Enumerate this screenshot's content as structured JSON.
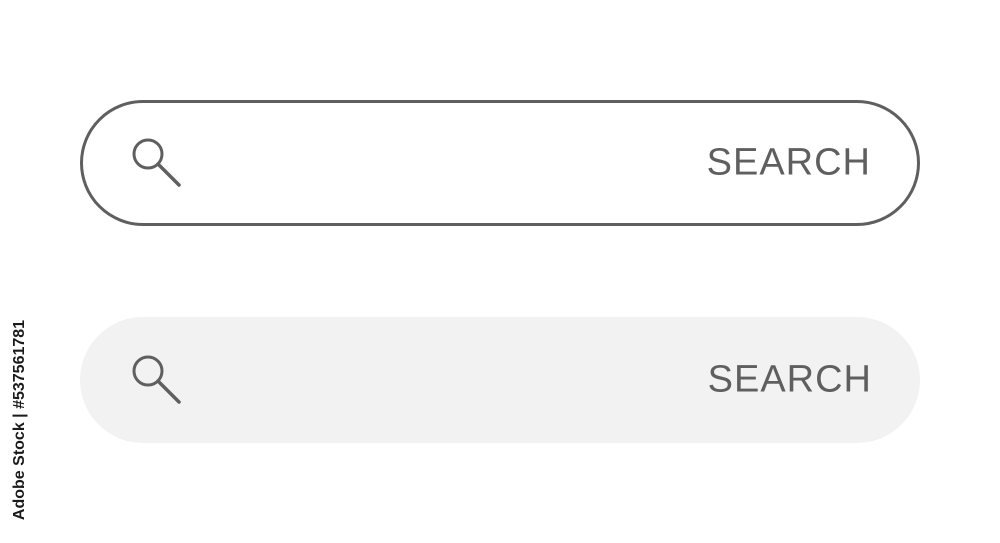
{
  "search_bars": [
    {
      "style": "outlined",
      "label": "SEARCH",
      "icon": "search-icon",
      "border_color": "#5f5f5f",
      "background_color": "#ffffff"
    },
    {
      "style": "filled",
      "label": "SEARCH",
      "icon": "search-icon",
      "background_color": "#f2f2f2"
    }
  ],
  "colors": {
    "text": "#5f5f5f",
    "page_background": "#ffffff"
  },
  "watermark": {
    "text": "Adobe Stock | #537561781"
  }
}
